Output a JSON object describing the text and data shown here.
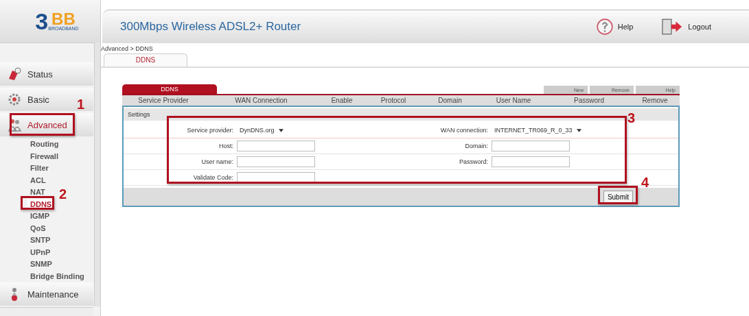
{
  "logo": {
    "mark": "3",
    "letters": "BB",
    "tagline": "BROADBAND"
  },
  "header": {
    "title": "300Mbps Wireless ADSL2+ Router",
    "help": "Help",
    "logout": "Logout"
  },
  "sidebar": {
    "items": [
      {
        "label": "Status",
        "kind": "section",
        "selected": false
      },
      {
        "label": "Basic",
        "kind": "section",
        "selected": false
      },
      {
        "label": "Advanced",
        "kind": "section",
        "selected": true
      },
      {
        "label": "Routing",
        "kind": "sub",
        "selected": false
      },
      {
        "label": "Firewall",
        "kind": "sub",
        "selected": false
      },
      {
        "label": "Filter",
        "kind": "sub",
        "selected": false
      },
      {
        "label": "ACL",
        "kind": "sub",
        "selected": false
      },
      {
        "label": "NAT",
        "kind": "sub",
        "selected": false
      },
      {
        "label": "DDNS",
        "kind": "sub",
        "selected": true
      },
      {
        "label": "IGMP",
        "kind": "sub",
        "selected": false
      },
      {
        "label": "QoS",
        "kind": "sub",
        "selected": false
      },
      {
        "label": "SNTP",
        "kind": "sub",
        "selected": false
      },
      {
        "label": "UPnP",
        "kind": "sub",
        "selected": false
      },
      {
        "label": "SNMP",
        "kind": "sub",
        "selected": false
      },
      {
        "label": "Bridge Binding",
        "kind": "sub",
        "selected": false
      },
      {
        "label": "Maintenance",
        "kind": "section",
        "selected": false
      }
    ]
  },
  "breadcrumb": "Advanced > DDNS",
  "tabs": [
    {
      "label": "DDNS",
      "selected": true
    }
  ],
  "panel": {
    "title": "DDNS",
    "buttons": [
      "New",
      "Remove",
      "Help"
    ],
    "columns": [
      "Service Provider",
      "WAN Connection",
      "Enable",
      "Protocol",
      "Domain",
      "User Name",
      "Password",
      "Remove"
    ],
    "settings_label": "Settings",
    "fields": [
      [
        {
          "label": "Service provider:",
          "kind": "select",
          "value": "DynDNS.org"
        },
        {
          "label": "WAN connection:",
          "kind": "select",
          "value": "INTERNET_TR069_R_0_33"
        }
      ],
      [
        {
          "label": "Host:",
          "kind": "input"
        },
        {
          "label": "Domain:",
          "kind": "input"
        }
      ],
      [
        {
          "label": "User name:",
          "kind": "input"
        },
        {
          "label": "Password:",
          "kind": "input"
        }
      ],
      [
        {
          "label": "Validate Code:",
          "kind": "input"
        }
      ]
    ],
    "submit": "Submit"
  },
  "annotations": [
    "1",
    "2",
    "3",
    "4"
  ]
}
